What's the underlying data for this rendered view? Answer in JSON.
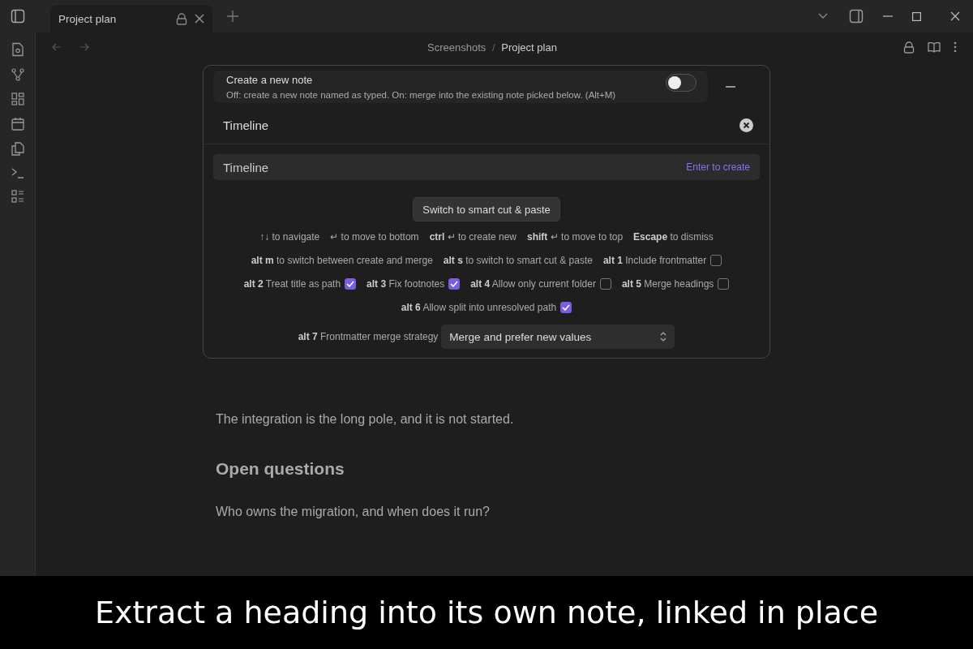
{
  "tab": {
    "title": "Project plan",
    "selected": true
  },
  "breadcrumb": {
    "folder": "Screenshots",
    "separator": "/",
    "note": "Project plan"
  },
  "note": [
    {
      "kind": "paragraph",
      "text": "The integration is the long pole, and it is not started."
    },
    {
      "kind": "heading",
      "text": "Open questions"
    },
    {
      "kind": "paragraph",
      "text": "Who owns the migration, and when does it run?"
    }
  ],
  "modal": {
    "toggle": {
      "title": "Create a new note",
      "description": "Off: create a new note named as typed. On: merge into the existing note picked below. (Alt+M)",
      "on": false
    },
    "input": {
      "value": "Timeline"
    },
    "suggestions": [
      {
        "label": "Timeline",
        "hint": "Enter to create",
        "selected": true
      }
    ],
    "button": "Switch to smart cut & paste",
    "hint_lines": [
      {
        "items": [
          {
            "kind": "hint",
            "text": "↑↓ to navigate"
          },
          {
            "kind": "hint",
            "text": "↵ to move to bottom"
          },
          {
            "kind": "hint",
            "text": "**ctrl** ↵ to create new"
          },
          {
            "kind": "hint",
            "text": "**shift** ↵ to move to top"
          },
          {
            "kind": "hint",
            "text": "**Escape** to dismiss"
          }
        ]
      },
      {
        "items": [
          {
            "kind": "hint",
            "text": "**alt m** to switch between create and merge"
          },
          {
            "kind": "hint",
            "text": "**alt s** to switch to smart cut & paste"
          },
          {
            "kind": "checkbox",
            "text": "**alt 1** Include frontmatter",
            "checked": false
          }
        ]
      },
      {
        "items": [
          {
            "kind": "checkbox",
            "text": "**alt 2** Treat title as path",
            "checked": true
          },
          {
            "kind": "checkbox",
            "text": "**alt 3** Fix footnotes",
            "checked": true
          },
          {
            "kind": "checkbox",
            "text": "**alt 4** Allow only current folder",
            "checked": false
          },
          {
            "kind": "checkbox",
            "text": "**alt 5** Merge headings",
            "checked": false
          }
        ]
      },
      {
        "items": [
          {
            "kind": "checkbox",
            "text": "**alt 6** Allow split into unresolved path",
            "checked": true
          }
        ]
      }
    ],
    "strategy": {
      "label": "**alt 7** Frontmatter merge strategy",
      "value": "Merge and prefer new values"
    }
  },
  "caption": "Extract a heading into its own note, linked in place"
}
